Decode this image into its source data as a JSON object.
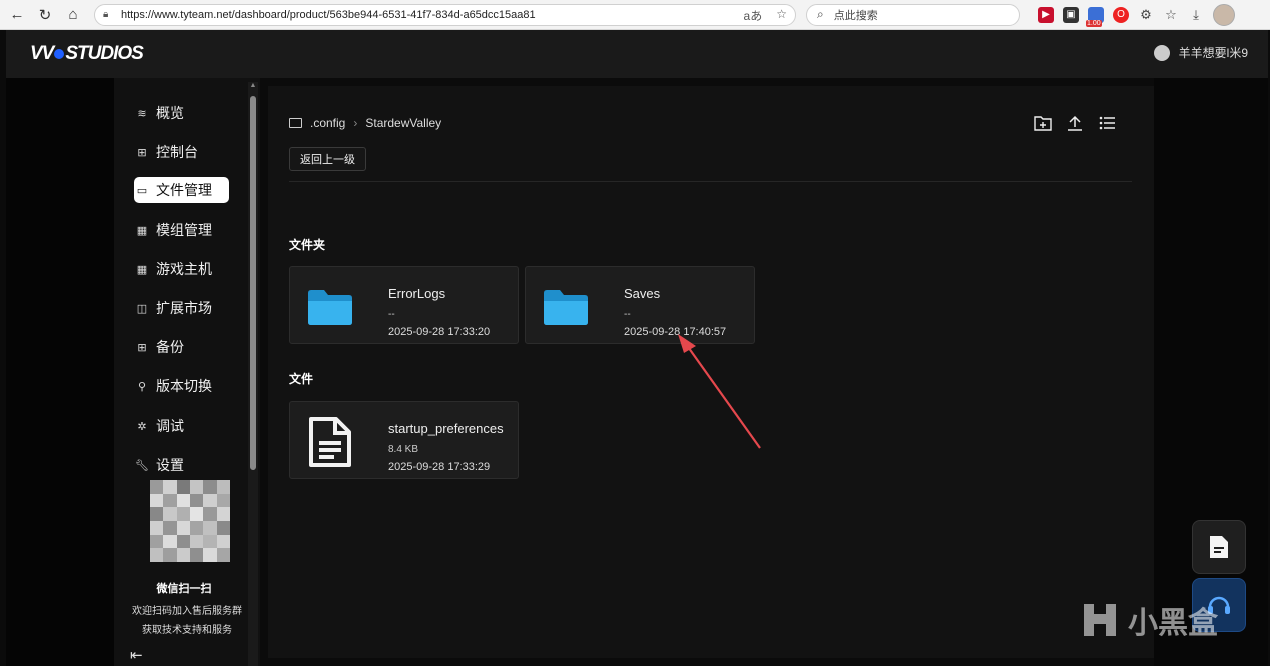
{
  "browser": {
    "url": "https://www.tyteam.net/dashboard/product/563be944-6531-41f7-834d-a65dcc15aa81",
    "search_placeholder": "点此搜索",
    "ext_badge": "1.00"
  },
  "header": {
    "logo": "WDSTUDIOS",
    "username": "羊羊想要l米9"
  },
  "sidebar": {
    "items": [
      {
        "label": "概览",
        "icon": "layers-icon"
      },
      {
        "label": "控制台",
        "icon": "grid-icon"
      },
      {
        "label": "文件管理",
        "icon": "folder-icon"
      },
      {
        "label": "模组管理",
        "icon": "module-icon"
      },
      {
        "label": "游戏主机",
        "icon": "server-icon"
      },
      {
        "label": "扩展市场",
        "icon": "bag-icon"
      },
      {
        "label": "备份",
        "icon": "backup-icon"
      },
      {
        "label": "版本切换",
        "icon": "switch-icon"
      },
      {
        "label": "调试",
        "icon": "bug-icon"
      },
      {
        "label": "设置",
        "icon": "wrench-icon"
      }
    ],
    "qr_title": "微信扫一扫",
    "qr_desc1": "欢迎扫码加入售后服务群",
    "qr_desc2": "获取技术支持和服务"
  },
  "main": {
    "breadcrumb": [
      ".config",
      "StardewValley"
    ],
    "back_label": "返回上一级",
    "folders_title": "文件夹",
    "files_title": "文件",
    "folders": [
      {
        "name": "ErrorLogs",
        "size": "--",
        "date": "2025-09-28 17:33:20"
      },
      {
        "name": "Saves",
        "size": "--",
        "date": "2025-09-28 17:40:57"
      }
    ],
    "files": [
      {
        "name": "startup_preferences",
        "size": "8.4 KB",
        "date": "2025-09-28 17:33:29"
      }
    ]
  },
  "watermark": "小黑盒",
  "colors": {
    "accent_blue": "#2aa8e6",
    "annotation_arrow": "#e5484d"
  }
}
